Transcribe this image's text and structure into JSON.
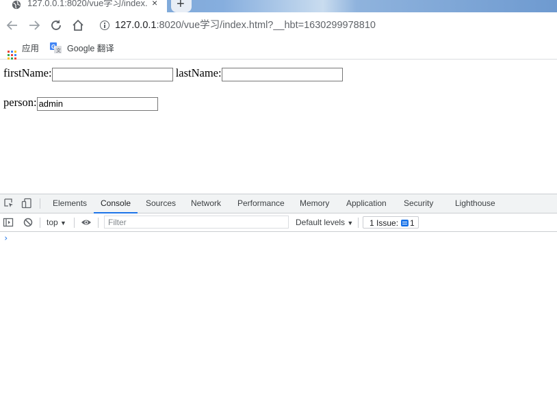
{
  "browser": {
    "tab": {
      "title": "127.0.0.1:8020/vue学习/index.h",
      "close_glyph": "×",
      "favicon": "globe-icon"
    },
    "new_tab_glyph": "+",
    "url": {
      "host": "127.0.0.1",
      "rest": ":8020/vue学习/index.html?__hbt=1630299978810"
    },
    "bookmarks": [
      {
        "label": "应用",
        "icon": "apps-grid-icon"
      },
      {
        "label": "Google 翻译",
        "icon": "google-translate-icon"
      }
    ]
  },
  "page": {
    "first_name_label": "firstName:",
    "first_name_value": "",
    "last_name_label": "lastName:",
    "last_name_value": "",
    "person_label": "person:",
    "person_value": "admin"
  },
  "devtools": {
    "tabs": [
      "Elements",
      "Console",
      "Sources",
      "Network",
      "Performance",
      "Memory",
      "Application",
      "Security",
      "Lighthouse"
    ],
    "active_tab": "Console",
    "console": {
      "context": "top",
      "filter_placeholder": "Filter",
      "levels": "Default levels",
      "issues_label": "1 Issue:",
      "issues_count": "1",
      "prompt": "›"
    }
  },
  "colors": {
    "accent": "#1a73e8",
    "devtools_bar": "#f1f3f4"
  }
}
